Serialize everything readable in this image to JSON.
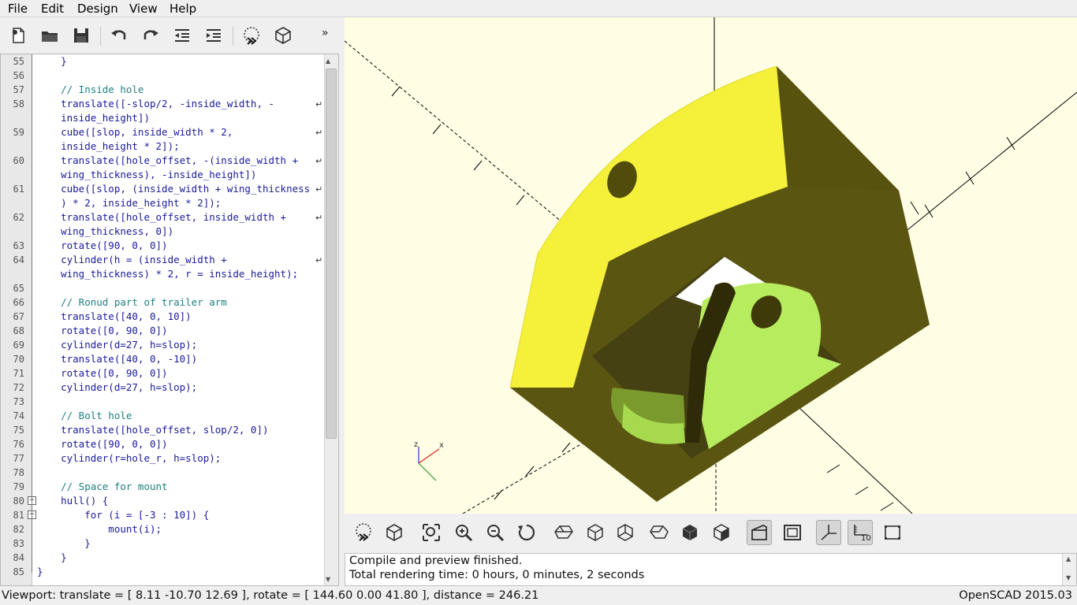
{
  "menu": {
    "file": "File",
    "edit": "Edit",
    "design": "Design",
    "view": "View",
    "help": "Help"
  },
  "toolbar": {
    "more": "»"
  },
  "editor": {
    "lines": [
      {
        "n": "55",
        "text": "    }"
      },
      {
        "n": "56",
        "text": ""
      },
      {
        "n": "57",
        "text": "    // Inside hole"
      },
      {
        "n": "58",
        "text": "    translate([-slop/2, -inside_width, -"
      },
      {
        "n": "",
        "text": "    inside_height])"
      },
      {
        "n": "59",
        "text": "    cube([slop, inside_width * 2,"
      },
      {
        "n": "",
        "text": "    inside_height * 2]);"
      },
      {
        "n": "60",
        "text": "    translate([hole_offset, -(inside_width +"
      },
      {
        "n": "",
        "text": "    wing_thickness), -inside_height])"
      },
      {
        "n": "61",
        "text": "    cube([slop, (inside_width + wing_thickness"
      },
      {
        "n": "",
        "text": "    ) * 2, inside_height * 2]);"
      },
      {
        "n": "62",
        "text": "    translate([hole_offset, inside_width +"
      },
      {
        "n": "",
        "text": "    wing_thickness, 0])"
      },
      {
        "n": "63",
        "text": "    rotate([90, 0, 0])"
      },
      {
        "n": "64",
        "text": "    cylinder(h = (inside_width +"
      },
      {
        "n": "",
        "text": "    wing_thickness) * 2, r = inside_height);"
      },
      {
        "n": "65",
        "text": ""
      },
      {
        "n": "66",
        "text": "    // Ronud part of trailer arm"
      },
      {
        "n": "67",
        "text": "    translate([40, 0, 10])"
      },
      {
        "n": "68",
        "text": "    rotate([0, 90, 0])"
      },
      {
        "n": "69",
        "text": "    cylinder(d=27, h=slop);"
      },
      {
        "n": "70",
        "text": "    translate([40, 0, -10])"
      },
      {
        "n": "71",
        "text": "    rotate([0, 90, 0])"
      },
      {
        "n": "72",
        "text": "    cylinder(d=27, h=slop);"
      },
      {
        "n": "73",
        "text": ""
      },
      {
        "n": "74",
        "text": "    // Bolt hole"
      },
      {
        "n": "75",
        "text": "    translate([hole_offset, slop/2, 0])"
      },
      {
        "n": "76",
        "text": "    rotate([90, 0, 0])"
      },
      {
        "n": "77",
        "text": "    cylinder(r=hole_r, h=slop);"
      },
      {
        "n": "78",
        "text": ""
      },
      {
        "n": "79",
        "text": "    // Space for mount"
      },
      {
        "n": "80",
        "text": "    hull() {"
      },
      {
        "n": "81",
        "text": "        for (i = [-3 : 10]) {"
      },
      {
        "n": "82",
        "text": "            mount(i);"
      },
      {
        "n": "83",
        "text": "        }"
      },
      {
        "n": "84",
        "text": "    }"
      },
      {
        "n": "85",
        "text": "}"
      }
    ]
  },
  "viewport": {
    "axis_x": "x",
    "axis_z": "z",
    "colors": {
      "background": "#fffee5",
      "face_light": "#f5f03a",
      "face_dark": "#5a5510",
      "inner_light": "#b7ec5e"
    }
  },
  "view_toolbar": {
    "scale_label": "10"
  },
  "console": {
    "line1": "Compile and preview finished.",
    "line2": "Total rendering time: 0 hours, 0 minutes, 2 seconds"
  },
  "status": {
    "viewport": "Viewport: translate = [ 8.11 -10.70 12.69 ], rotate = [ 144.60 0.00 41.80 ], distance = 246.21",
    "version": "OpenSCAD 2015.03"
  }
}
